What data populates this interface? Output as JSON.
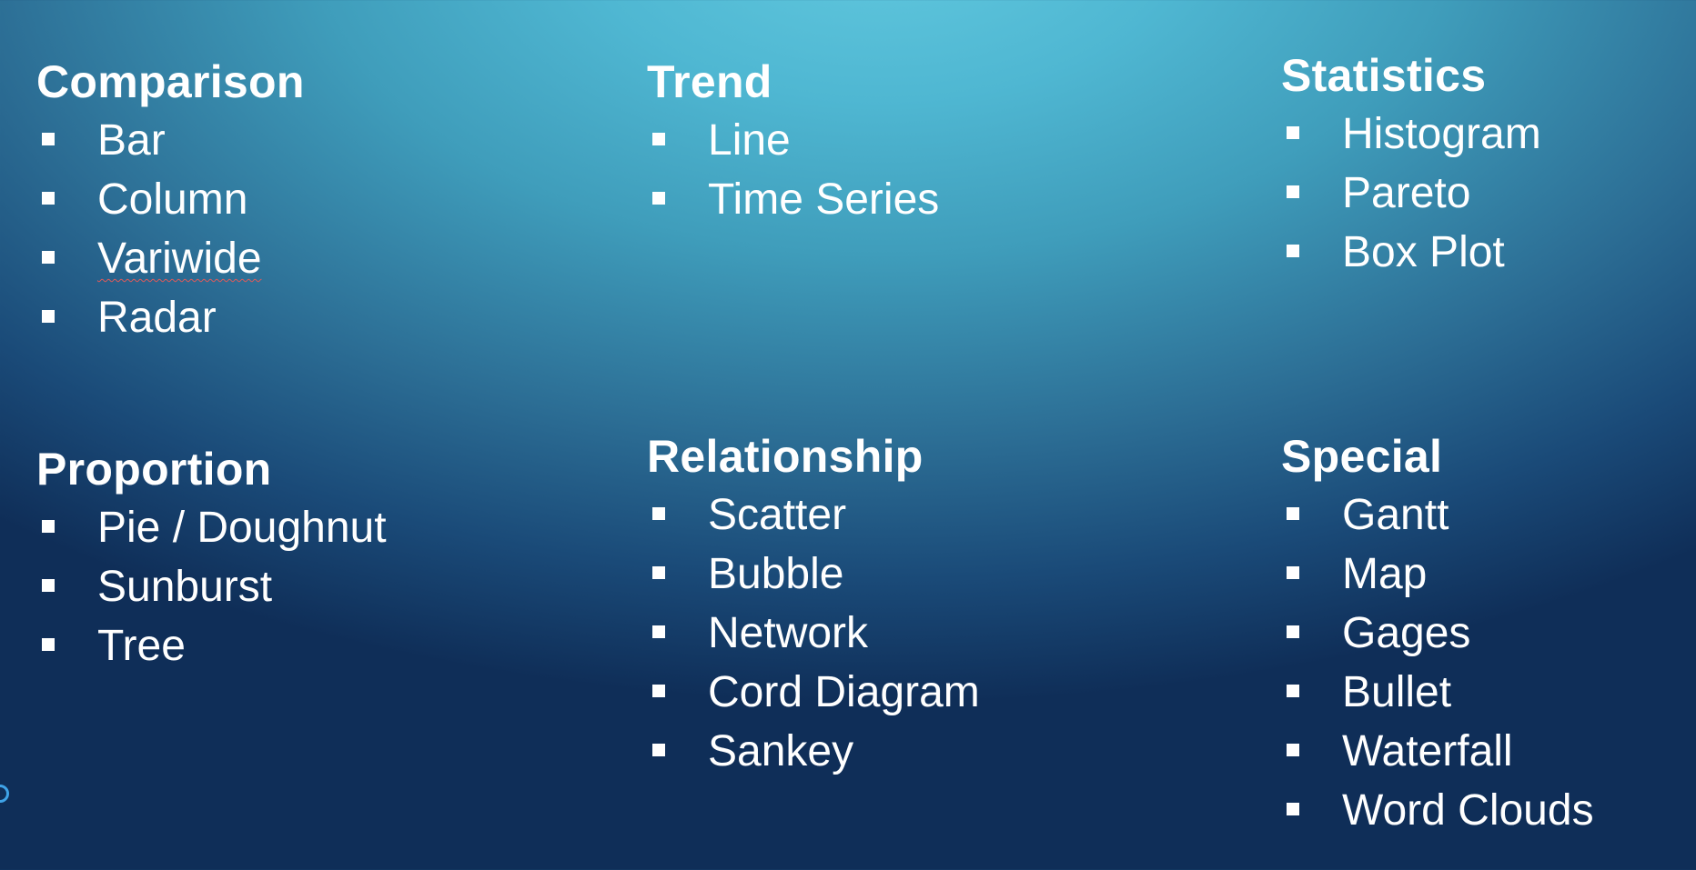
{
  "sections": [
    {
      "heading": "Comparison",
      "items": [
        "Bar",
        "Column",
        "Variwide",
        "Radar"
      ]
    },
    {
      "heading": "Trend",
      "items": [
        "Line",
        "Time Series"
      ]
    },
    {
      "heading": "Statistics",
      "items": [
        "Histogram",
        "Pareto",
        "Box Plot"
      ]
    },
    {
      "heading": "Proportion",
      "items": [
        "Pie / Doughnut",
        "Sunburst",
        "Tree"
      ]
    },
    {
      "heading": "Relationship",
      "items": [
        "Scatter",
        "Bubble",
        "Network",
        "Cord Diagram",
        "Sankey"
      ]
    },
    {
      "heading": "Special",
      "items": [
        "Gantt",
        "Map",
        "Gages",
        "Bullet",
        "Waterfall",
        "Word Clouds"
      ]
    }
  ],
  "colors": {
    "background_top": "#62c9df",
    "background_bottom": "#0f2e58",
    "text": "#ffffff",
    "spellcheck_underline": "#e05a5a",
    "selection_handle": "#3fa3e8"
  },
  "icons": {
    "bullet": "square-bullet-icon",
    "handle": "circle-handle-icon"
  }
}
